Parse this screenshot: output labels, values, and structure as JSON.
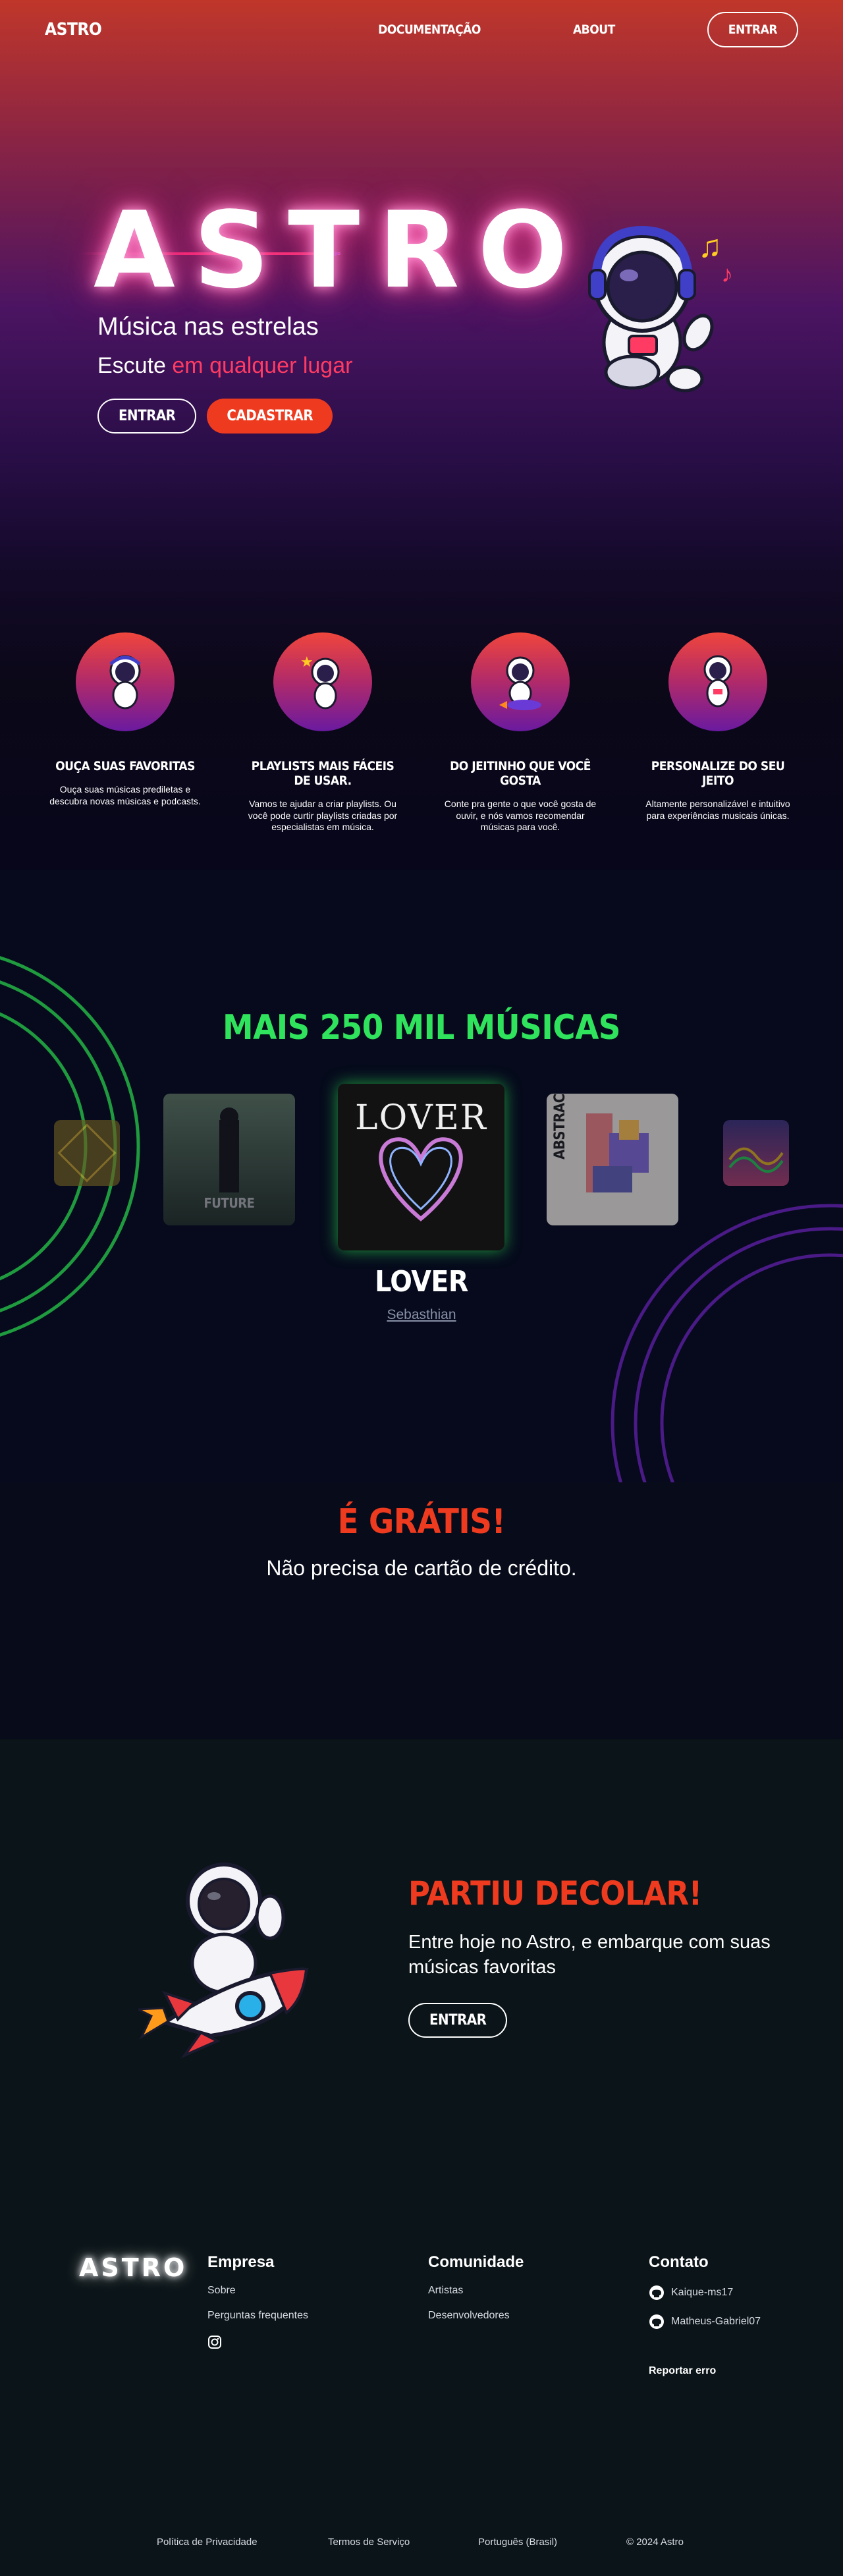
{
  "nav": {
    "logo": "ASTRO",
    "links": [
      "DOCUMENTAÇÃO",
      "ABOUT"
    ],
    "cta": "ENTRAR"
  },
  "hero": {
    "title": "ASTRO",
    "subtitle": "Música nas estrelas",
    "tagline_prefix": "Escute ",
    "tagline_accent": "em qualquer lugar",
    "login": "ENTRAR",
    "signup": "CADASTRAR"
  },
  "features": [
    {
      "title": "OUÇA SUAS FAVORITAS",
      "text": "Ouça suas músicas prediletas e descubra novas músicas e podcasts."
    },
    {
      "title": "PLAYLISTS MAIS FÁCEIS DE USAR.",
      "text": "Vamos te ajudar a criar playlists. Ou você pode curtir playlists criadas por especialistas em música."
    },
    {
      "title": "DO JEITINHO QUE VOCÊ GOSTA",
      "text": "Conte pra gente o que você gosta de ouvir, e nós vamos recomendar músicas para você."
    },
    {
      "title": "PERSONALIZE DO SEU JEITO",
      "text": "Altamente personalizável e intuitivo para experiências musicais únicas."
    }
  ],
  "music": {
    "heading": "MAIS 250 MIL MÚSICAS",
    "covers": [
      "",
      "FUTURE",
      "LOVER",
      "ABSTRACTION",
      ""
    ],
    "current_title": "LOVER",
    "current_artist": "Sebasthian"
  },
  "free": {
    "heading": "É GRÁTIS!",
    "text": "Não precisa de cartão de crédito."
  },
  "cta": {
    "heading": "PARTIU DECOLAR!",
    "text": "Entre hoje no Astro, e embarque com suas músicas favoritas",
    "button": "ENTRAR"
  },
  "footer": {
    "logo": "ASTRO",
    "empresa": {
      "title": "Empresa",
      "items": [
        "Sobre",
        "Perguntas frequentes"
      ]
    },
    "comunidade": {
      "title": "Comunidade",
      "items": [
        "Artistas",
        "Desenvolvedores"
      ]
    },
    "contato": {
      "title": "Contato",
      "items": [
        "Kaique-ms17",
        "Matheus-Gabriel07"
      ],
      "report": "Reportar erro"
    },
    "bottom": [
      "Política de Privacidade",
      "Termos de Serviço",
      "Português (Brasil)",
      "© 2024 Astro"
    ]
  },
  "colors": {
    "accent_red": "#ee3b1f",
    "accent_green": "#2fe35c",
    "accent_pink": "#ff3b63",
    "ring_purple": "#5a1f9a"
  }
}
